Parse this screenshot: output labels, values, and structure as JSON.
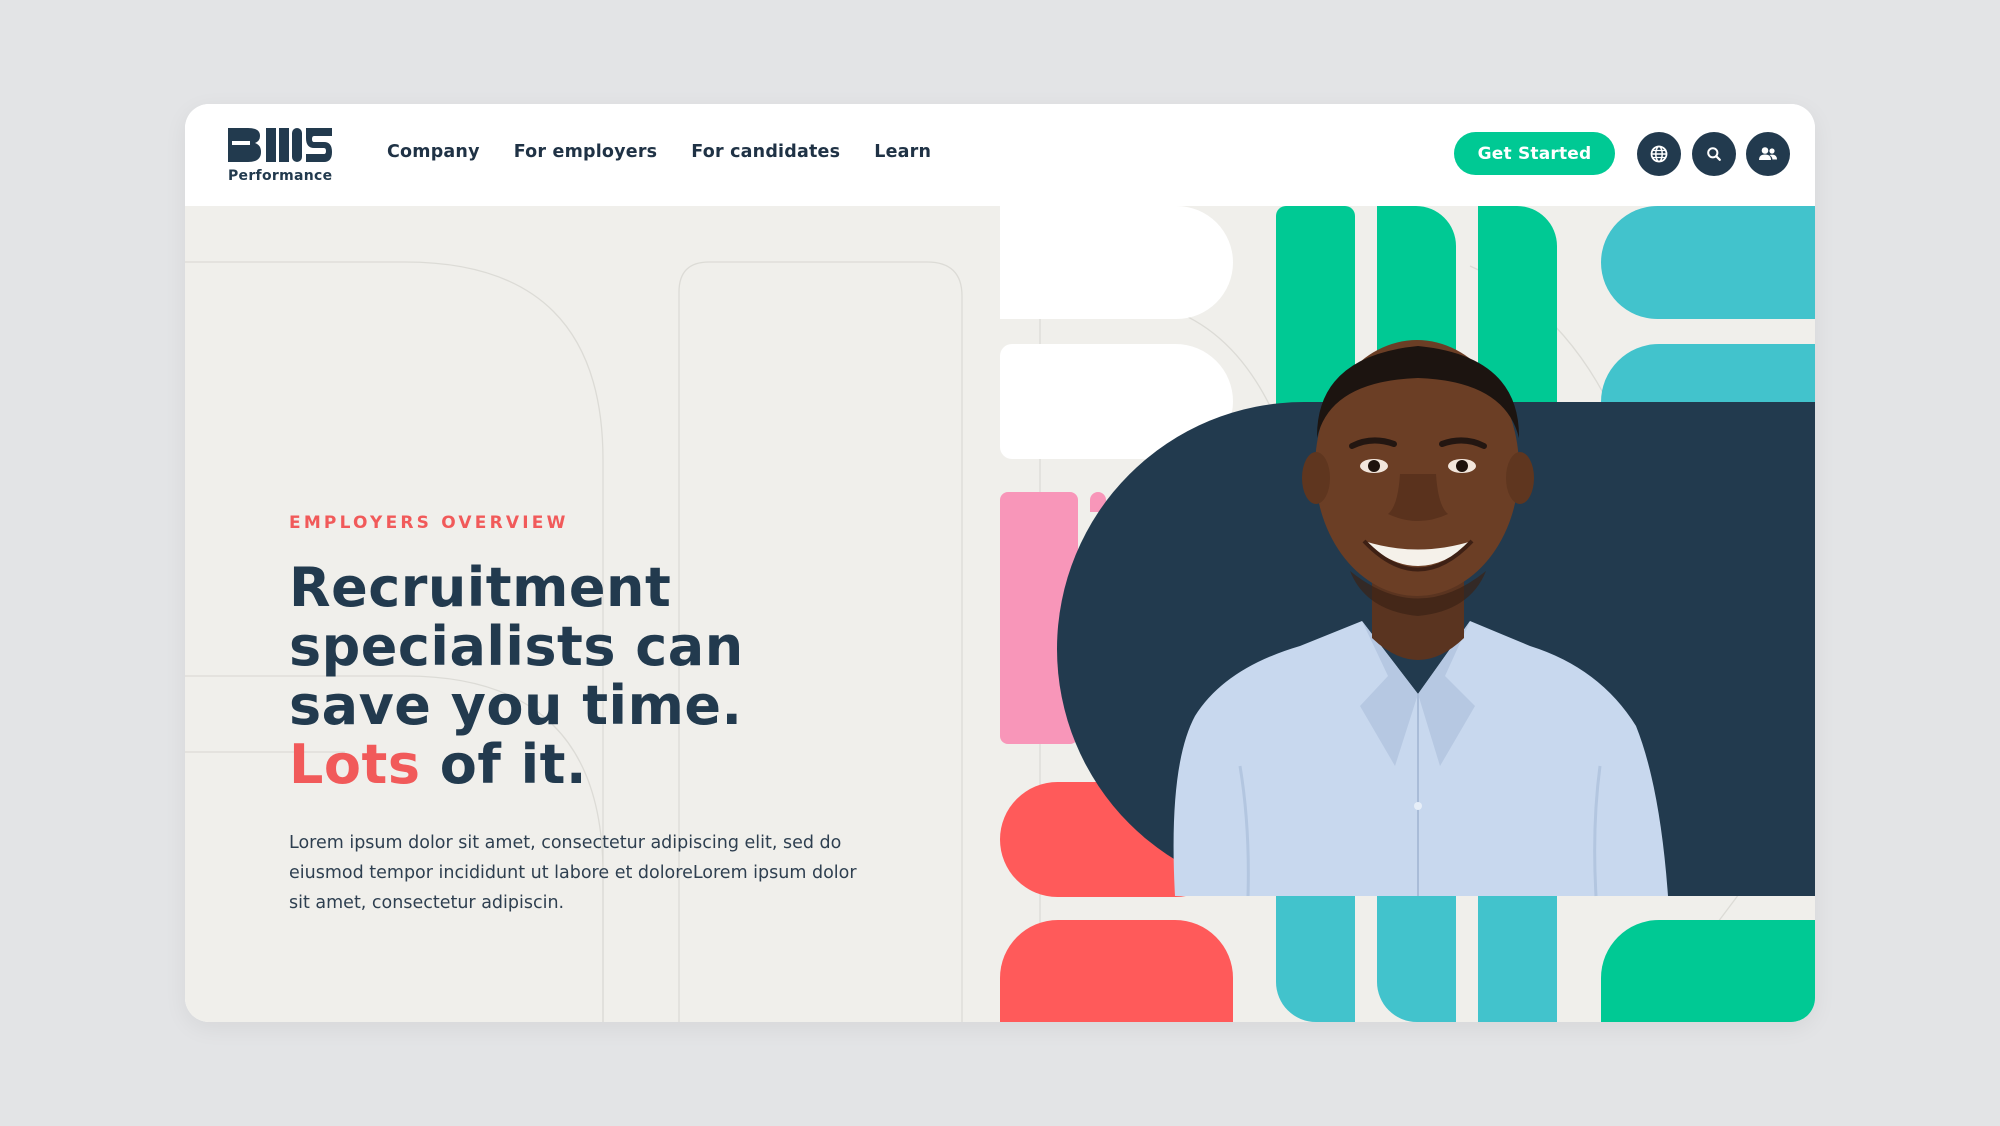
{
  "brand": {
    "logo_text": "BMS",
    "logo_sub": "Performance"
  },
  "nav": {
    "links": [
      "Company",
      "For employers",
      "For candidates",
      "Learn"
    ],
    "cta": "Get Started",
    "icons": [
      "globe-icon",
      "search-icon",
      "user-group-icon"
    ]
  },
  "hero": {
    "eyebrow": "EMPLOYERS OVERVIEW",
    "headline_line1": "Recruitment",
    "headline_line2": "specialists can",
    "headline_line3": "save you time.",
    "headline_accent": "Lots",
    "headline_tail": " of it.",
    "body": "Lorem ipsum dolor sit amet, consectetur adipiscing elit, sed do eiusmod tempor incididunt ut labore et doloreLorem ipsum dolor sit amet, consectetur adipiscin."
  },
  "colors": {
    "navy": "#223a4e",
    "green": "#00c994",
    "teal": "#42c3cc",
    "coral": "#ff5a5a",
    "pink": "#f896b9",
    "cream": "#f0efeb"
  }
}
